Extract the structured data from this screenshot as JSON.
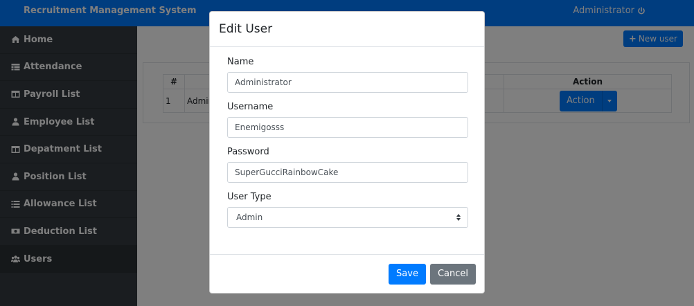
{
  "app": {
    "brand": "Recruitment Management System",
    "user_label": "Administrator"
  },
  "sidebar": {
    "items": [
      {
        "label": "Home",
        "icon": "home-icon"
      },
      {
        "label": "Attendance",
        "icon": "table-icon"
      },
      {
        "label": "Payroll List",
        "icon": "columns-icon"
      },
      {
        "label": "Employee List",
        "icon": "user-tie-icon"
      },
      {
        "label": "Depatment List",
        "icon": "columns-icon"
      },
      {
        "label": "Position List",
        "icon": "user-tie-icon"
      },
      {
        "label": "Allowance List",
        "icon": "list-icon"
      },
      {
        "label": "Deduction List",
        "icon": "money-bill-icon"
      },
      {
        "label": "Users",
        "icon": "users-icon",
        "active": true
      }
    ]
  },
  "main": {
    "new_user_label": "New user",
    "table": {
      "headers": [
        "#",
        "",
        "Action"
      ],
      "rows": [
        {
          "num": "1",
          "name": "Admin",
          "action_label": "Action"
        }
      ]
    }
  },
  "modal": {
    "title": "Edit User",
    "fields": {
      "name_label": "Name",
      "name_value": "Administrator",
      "username_label": "Username",
      "username_value": "Enemigosss",
      "password_label": "Password",
      "password_value": "SuperGucciRainbowCake",
      "usertype_label": "User Type",
      "usertype_value": "Admin"
    },
    "save_label": "Save",
    "cancel_label": "Cancel"
  },
  "colors": {
    "primary": "#007bff",
    "sidebar": "#343a40",
    "secondary": "#6c757d"
  }
}
